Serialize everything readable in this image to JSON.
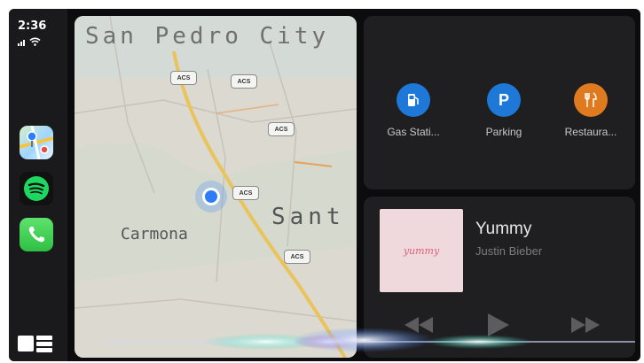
{
  "status": {
    "time": "2:36"
  },
  "sidebar": {
    "apps": [
      {
        "name": "Maps",
        "icon": "maps-app-icon"
      },
      {
        "name": "Spotify",
        "icon": "spotify-app-icon"
      },
      {
        "name": "Phone",
        "icon": "phone-app-icon"
      }
    ],
    "dashboard_icon": "dashboard-grid-icon"
  },
  "map": {
    "labels": {
      "san_pedro": "San Pedro City",
      "carmona": "Carmona",
      "santa": "Sant"
    },
    "road_shields": [
      "ACS",
      "ACS",
      "ACS",
      "ACS",
      "ACS"
    ]
  },
  "poi": {
    "items": [
      {
        "label": "Gas Stati...",
        "icon": "gas-station-icon",
        "color": "#1e78d8"
      },
      {
        "label": "Parking",
        "icon": "parking-icon",
        "glyph": "P",
        "color": "#1e78d8"
      },
      {
        "label": "Restaura...",
        "icon": "restaurant-icon",
        "color": "#e07a1e"
      }
    ]
  },
  "now_playing": {
    "title": "Yummy",
    "artist": "Justin Bieber",
    "album_art_text": "yummy",
    "controls": [
      "previous-icon",
      "play-icon",
      "next-icon"
    ]
  },
  "colors": {
    "screen_bg": "#0c0c0e",
    "panel_bg": "#1f1f21",
    "accent_blue": "#1e78d8",
    "accent_orange": "#e07a1e"
  }
}
